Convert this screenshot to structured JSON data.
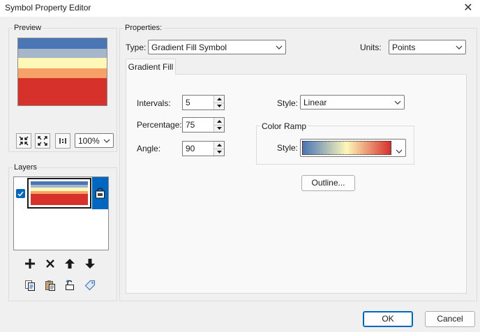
{
  "window": {
    "title": "Symbol Property Editor",
    "close_glyph": "✕"
  },
  "preview": {
    "label": "Preview",
    "bands": [
      "#4a76b6",
      "#a5b7c9",
      "#fdf7b8",
      "#f7a067",
      "#d6312b"
    ],
    "zoom_options": [
      "100%"
    ],
    "zoom_value": "100%",
    "tool_icons": [
      "zoom-fit-icon",
      "zoom-full-extent-icon",
      "actual-size-icon"
    ]
  },
  "layers": {
    "label": "Layers",
    "items": [
      {
        "checked": true,
        "selected": true
      }
    ],
    "action_icons": [
      "add-icon",
      "remove-icon",
      "move-up-icon",
      "move-down-icon"
    ],
    "edit_icons": [
      "copy-icon",
      "paste-icon",
      "unlock-icon",
      "tag-icon"
    ]
  },
  "properties": {
    "label": "Properties:",
    "type_label": "Type:",
    "type_value": "Gradient Fill Symbol",
    "units_label": "Units:",
    "units_value": "Points"
  },
  "tab": {
    "label": "Gradient Fill"
  },
  "gradient": {
    "intervals_label": "Intervals:",
    "intervals_value": "5",
    "percentage_label": "Percentage:",
    "percentage_value": "75",
    "angle_label": "Angle:",
    "angle_value": "90",
    "style_label": "Style:",
    "style_value": "Linear",
    "color_ramp_label": "Color Ramp",
    "ramp_style_label": "Style:",
    "ramp_colors": [
      "#4a76b6",
      "#fdf7b8",
      "#d6312b"
    ],
    "outline_label": "Outline..."
  },
  "footer": {
    "ok_label": "OK",
    "cancel_label": "Cancel"
  }
}
